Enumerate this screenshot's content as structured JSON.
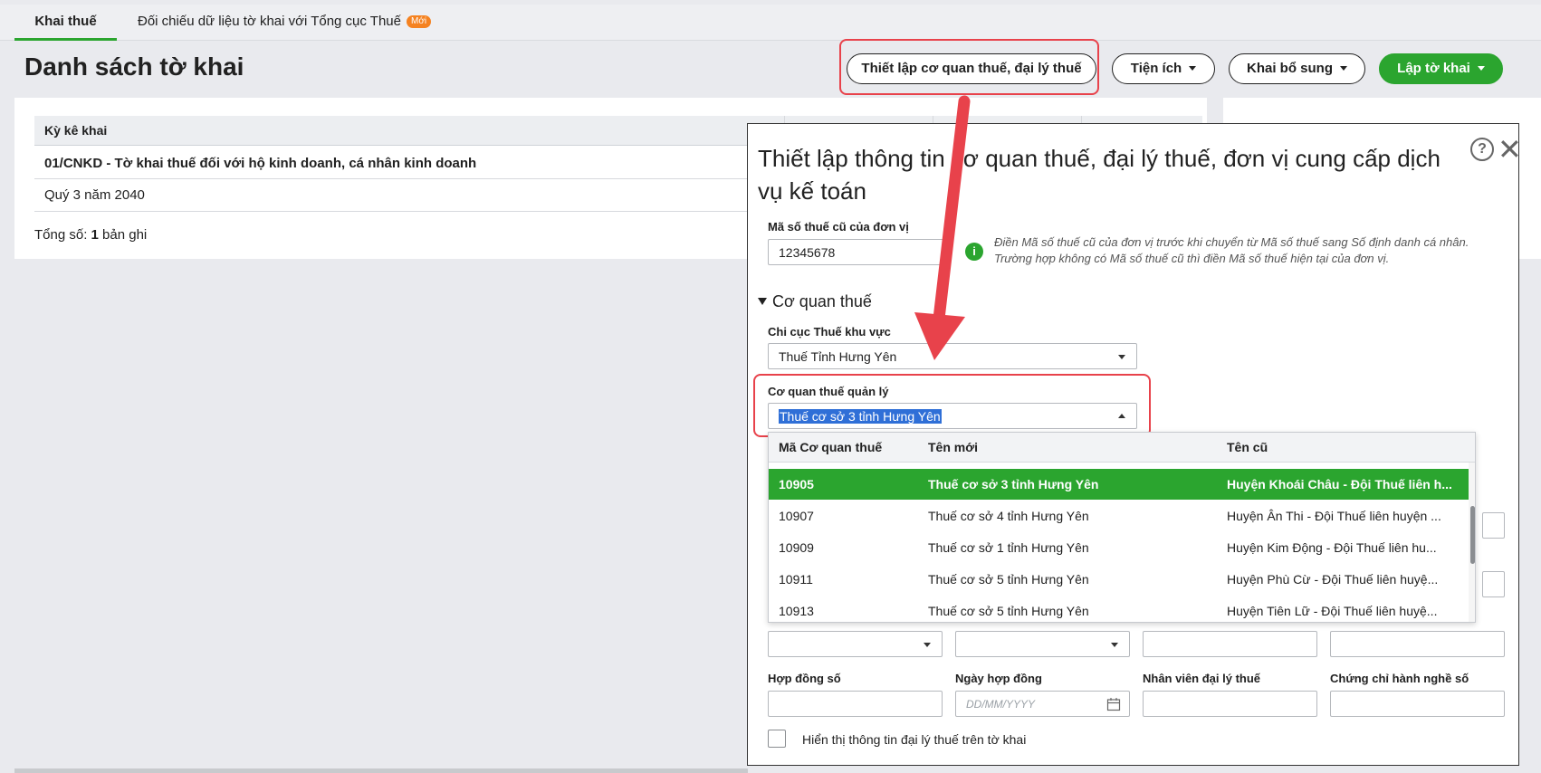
{
  "tabs": {
    "active": "Khai thuế",
    "second": "Đối chiếu dữ liệu tờ khai với Tổng cục Thuế",
    "second_badge": "Mới"
  },
  "header": {
    "title": "Danh sách tờ khai",
    "btn_setup": "Thiết lập cơ quan thuế, đại lý thuế",
    "btn_utilities": "Tiện ích",
    "btn_supplement": "Khai bổ sung",
    "btn_create": "Lập tờ khai"
  },
  "table": {
    "column_header": "Kỳ kê khai",
    "group_row": "01/CNKD - Tờ khai thuế đối với hộ kinh doanh, cá nhân kinh doanh",
    "data_row": "Quý 3 năm 2040",
    "total_prefix": "Tổng số: ",
    "total_count": "1",
    "total_suffix": " bản ghi"
  },
  "modal": {
    "title": "Thiết lập thông tin cơ quan thuế, đại lý thuế, đơn vị cung cấp dịch vụ kế toán",
    "old_tax_code_label": "Mã số thuế cũ của đơn vị",
    "old_tax_code_value": "12345678",
    "info_line1": "Điền Mã số thuế cũ của đơn vị trước khi chuyển từ Mã số thuế sang Số định danh cá nhân.",
    "info_line2": "Trường hợp không có Mã số thuế cũ thì điền Mã số thuế hiện tại của đơn vị.",
    "section_tax_office": "Cơ quan thuế",
    "regional_branch_label": "Chi cục Thuế khu vực",
    "regional_branch_value": "Thuế Tỉnh Hưng Yên",
    "managing_office_label": "Cơ quan thuế quản lý",
    "managing_office_value": "Thuế cơ sở 3 tỉnh Hưng Yên",
    "contract_no_label": "Hợp đồng số",
    "contract_date_label": "Ngày hợp đồng",
    "contract_date_placeholder": "DD/MM/YYYY",
    "agent_staff_label": "Nhân viên đại lý thuế",
    "certificate_label": "Chứng chỉ hành nghề số",
    "show_agent_label": "Hiển thị thông tin đại lý thuế trên tờ khai"
  },
  "dropdown": {
    "headers": [
      "Mã Cơ quan thuế",
      "Tên mới",
      "Tên cũ"
    ],
    "rows": [
      {
        "code": "10905",
        "new_name": "Thuế cơ sở 3 tỉnh Hưng Yên",
        "old_name": "Huyện Khoái Châu - Đội Thuế liên h..."
      },
      {
        "code": "10907",
        "new_name": "Thuế cơ sở 4 tỉnh Hưng Yên",
        "old_name": "Huyện Ân Thi - Đội Thuế liên huyện ..."
      },
      {
        "code": "10909",
        "new_name": "Thuế cơ sở 1 tỉnh Hưng Yên",
        "old_name": "Huyện Kim Động - Đội Thuế liên hu..."
      },
      {
        "code": "10911",
        "new_name": "Thuế cơ sở 5 tỉnh Hưng Yên",
        "old_name": "Huyện Phù Cừ - Đội Thuế liên huyệ..."
      },
      {
        "code": "10913",
        "new_name": "Thuế cơ sở 5 tỉnh Hưng Yên",
        "old_name": "Huyện Tiên Lữ - Đội Thuế liên huyệ..."
      }
    ]
  },
  "colors": {
    "accent_green": "#2ba52f",
    "highlight_red": "#e8424b",
    "badge_orange": "#f58220"
  }
}
